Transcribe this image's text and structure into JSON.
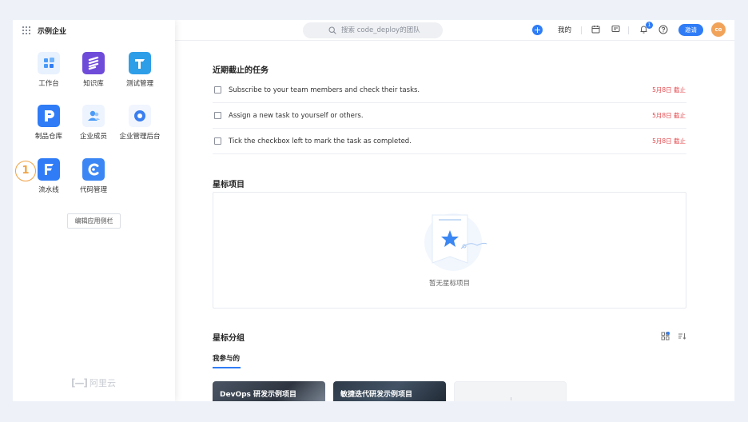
{
  "org": {
    "name": "示例企业"
  },
  "apps": [
    {
      "label": "工作台",
      "color": "#4a9bf7"
    },
    {
      "label": "知识库",
      "color": "#6f4bd9"
    },
    {
      "label": "测试管理",
      "color": "#2f9ee8"
    },
    {
      "label": "制品仓库",
      "color": "#2f7cf6"
    },
    {
      "label": "企业成员",
      "color": "#4a9bf7"
    },
    {
      "label": "企业管理后台",
      "color": "#3a7ff0"
    },
    {
      "label": "流水线",
      "color": "#2f7cf6"
    },
    {
      "label": "代码管理",
      "color": "#3b86f5"
    }
  ],
  "sidebar": {
    "edit_label": "编辑应用侧栏",
    "step_number": "1",
    "footer_logo": "阿里云"
  },
  "header": {
    "search_placeholder": "搜索 code_deploy的团队",
    "me_label": "我的",
    "notification_count": "1",
    "invite_label": "邀请",
    "avatar_initials": "co"
  },
  "tasks": {
    "title": "近期截止的任务",
    "items": [
      {
        "text": "Subscribe to your team members and check their tasks.",
        "due": "5月8日 截止"
      },
      {
        "text": "Assign a new task to yourself or others.",
        "due": "5月8日 截止"
      },
      {
        "text": "Tick the checkbox left to mark the task as completed.",
        "due": "5月8日 截止"
      }
    ]
  },
  "starred_projects": {
    "title": "星标项目",
    "empty_text": "暂无星标项目"
  },
  "starred_groups": {
    "title": "星标分组",
    "tab_label": "我参与的",
    "cards": [
      {
        "title": "DevOps 研发示例项目"
      },
      {
        "title": "敏捷迭代研发示例项目"
      }
    ]
  },
  "colors": {
    "accent": "#2f7cf6",
    "danger": "#e5484d",
    "avatar": "#f2a35a",
    "step": "#f0a345"
  }
}
